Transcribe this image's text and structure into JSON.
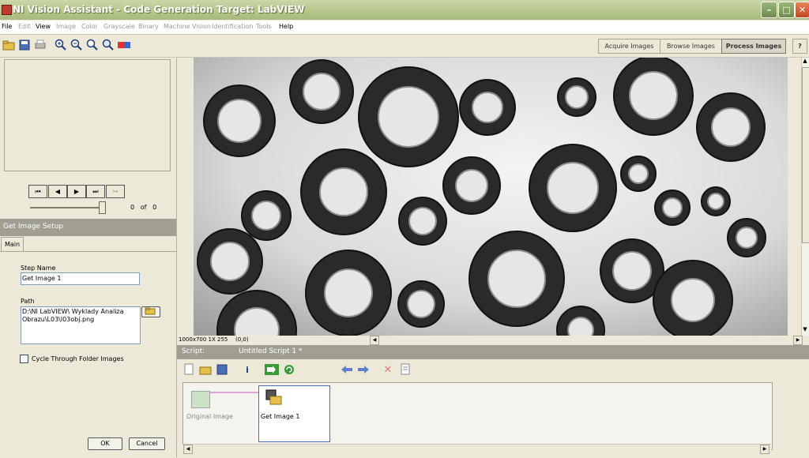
{
  "window": {
    "title": "NI Vision Assistant - Code Generation Target: LabVIEW"
  },
  "menu": [
    "File",
    "Edit",
    "View",
    "Image",
    "Color",
    "Grayscale",
    "Binary",
    "Machine Vision",
    "Identification",
    "Tools",
    "Help"
  ],
  "mode_tabs": {
    "acquire": "Acquire Images",
    "browse": "Browse Images",
    "process": "Process Images"
  },
  "help_icon_label": "?",
  "browser": {
    "counter_value": "0",
    "counter_of": "of",
    "counter_total": "0"
  },
  "setup": {
    "header": "Get Image Setup",
    "tab": "Main",
    "step_name_label": "Step Name",
    "step_name_value": "Get Image 1",
    "path_label": "Path",
    "path_value": "D:\\NI LabVIEW\\ Wyklady Analiza Obrazu\\L03\\l03obj.png",
    "cycle_label": "Cycle Through Folder Images",
    "cycle_checked": false,
    "ok_label": "OK",
    "cancel_label": "Cancel"
  },
  "image_status": {
    "info": "1000x700 1X 255",
    "coords": "(0,0)"
  },
  "script": {
    "label": "Script:",
    "name": "Untitled Script 1 *",
    "steps": [
      {
        "label": "Original Image",
        "active": false
      },
      {
        "label": "Get Image 1",
        "active": true
      }
    ]
  },
  "colors": {
    "accent": "#a19e92",
    "titlebar": "#b0c288"
  }
}
